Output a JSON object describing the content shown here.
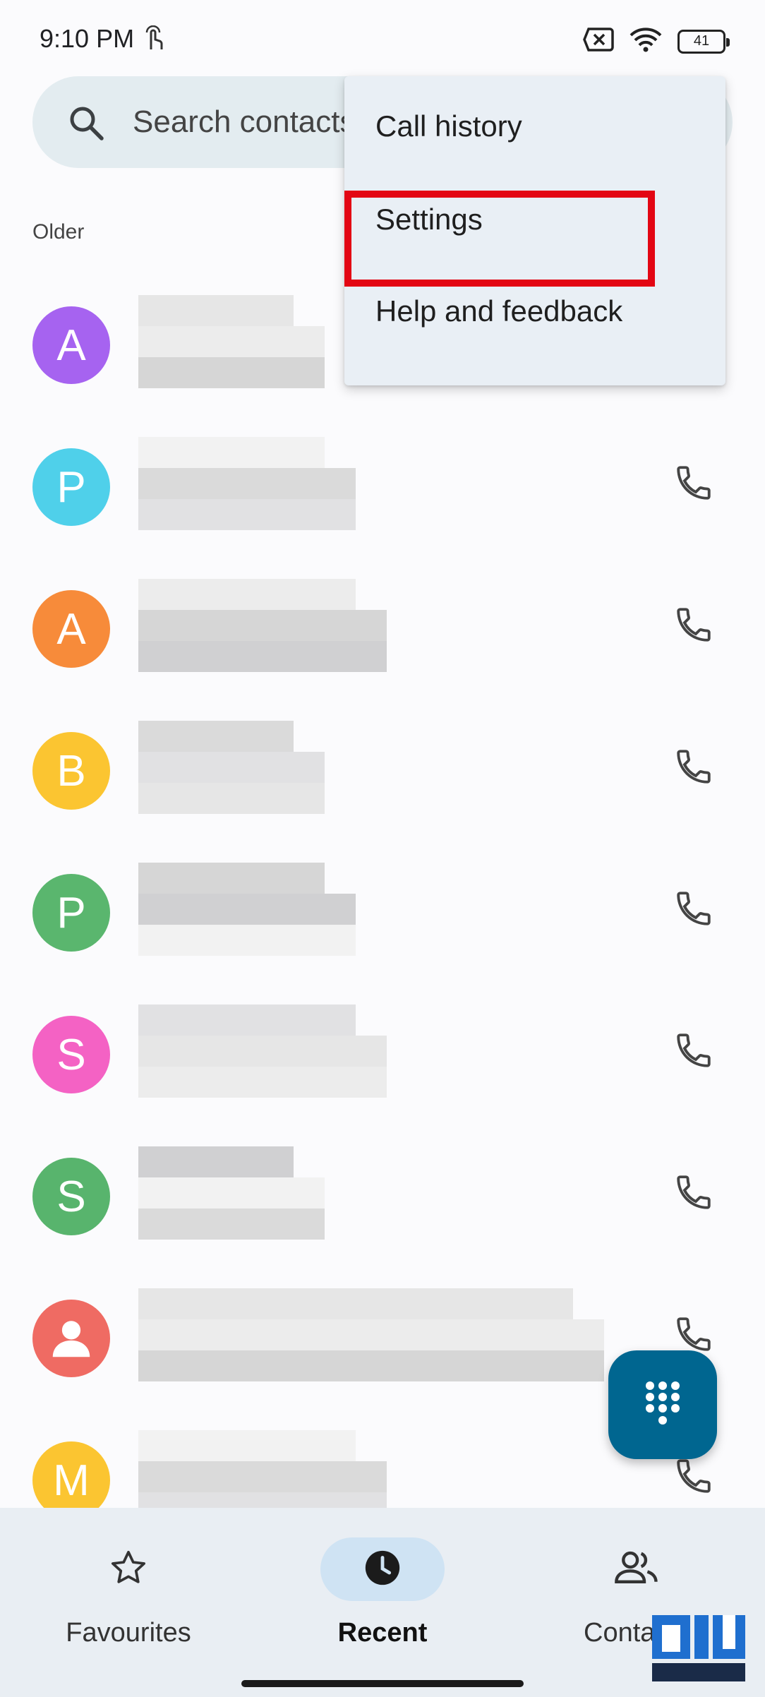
{
  "status_bar": {
    "time": "9:10 PM",
    "battery": "41"
  },
  "search": {
    "placeholder": "Search contacts"
  },
  "section_label": "Older",
  "menu": {
    "items": [
      {
        "label": "Call history"
      },
      {
        "label": "Settings"
      },
      {
        "label": "Help and feedback"
      }
    ],
    "highlight_color": "#e30613"
  },
  "contacts": [
    {
      "initial": "A",
      "color": "#a663f0",
      "icon": "letter-avatar"
    },
    {
      "initial": "P",
      "color": "#4fd0ea",
      "icon": "letter-avatar"
    },
    {
      "initial": "A",
      "color": "#f78b3a",
      "icon": "letter-avatar"
    },
    {
      "initial": "B",
      "color": "#fbc531",
      "icon": "letter-avatar"
    },
    {
      "initial": "P",
      "color": "#5ab66e",
      "icon": "letter-avatar"
    },
    {
      "initial": "S",
      "color": "#f462c4",
      "icon": "letter-avatar"
    },
    {
      "initial": "S",
      "color": "#58b46d",
      "icon": "letter-avatar"
    },
    {
      "initial": "",
      "color": "#ef6b63",
      "icon": "person-avatar"
    },
    {
      "initial": "M",
      "color": "#fbc531",
      "icon": "letter-avatar"
    }
  ],
  "fab": {
    "icon": "dialpad-icon",
    "color": "#006690"
  },
  "bottom_nav": {
    "items": [
      {
        "label": "Favourites",
        "icon": "star-icon",
        "active": false
      },
      {
        "label": "Recent",
        "icon": "clock-icon",
        "active": true
      },
      {
        "label": "Contacts",
        "icon": "people-icon",
        "active": false
      }
    ],
    "active_pill_color": "#cfe3f3"
  }
}
